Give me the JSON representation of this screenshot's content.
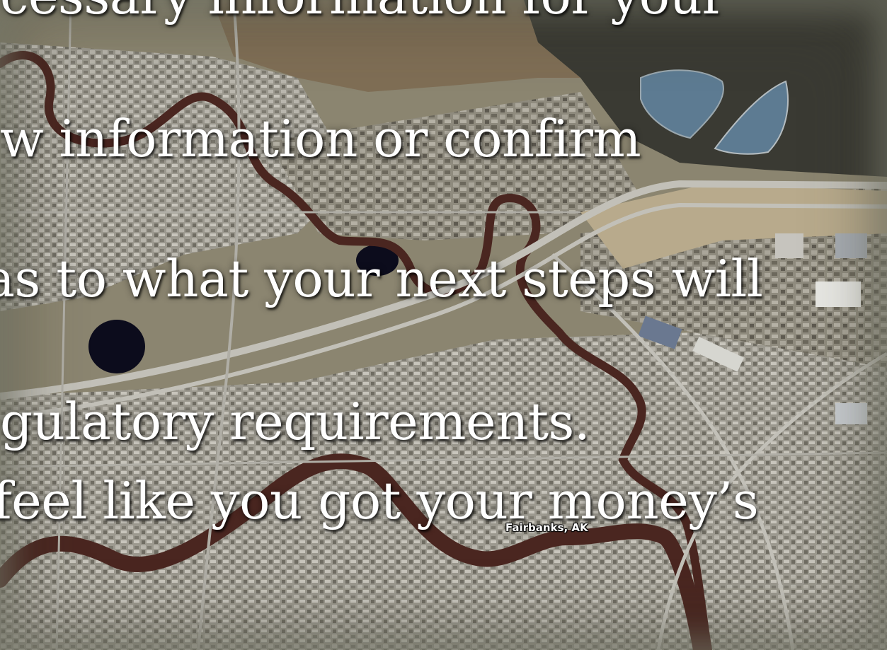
{
  "map": {
    "place_label": "Fairbanks, AK",
    "colors": {
      "land": "#8b8570",
      "urban": "#a7a59d",
      "forest": "#3a3a33",
      "river": "#4a2620",
      "pond": "#5d7b92",
      "dark_pond": "#0c0c1c",
      "road": "#c2c0b8",
      "border": "#7a7c6c"
    }
  },
  "slide": {
    "lines": [
      "cessary information for your",
      "w information or confirm",
      "as to what your next steps will",
      "gulatory requirements.",
      "feel like you got your money’s"
    ]
  }
}
